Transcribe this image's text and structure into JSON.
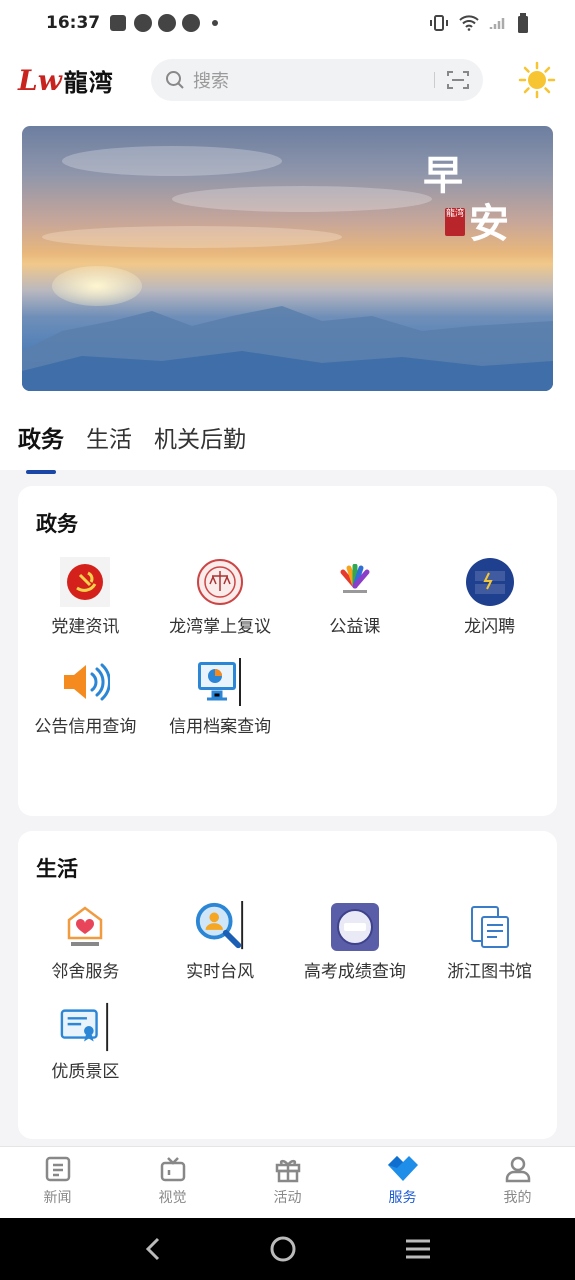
{
  "status_bar": {
    "time": "16:37"
  },
  "header": {
    "logo_mark": "Lw",
    "logo_text": "龍湾",
    "search_placeholder": "搜索"
  },
  "banner": {
    "greeting_line1": "早",
    "greeting_line2": "安",
    "seal_text": "龍湾"
  },
  "tabs": [
    {
      "label": "政务",
      "active": true
    },
    {
      "label": "生活",
      "active": false
    },
    {
      "label": "机关后勤",
      "active": false
    }
  ],
  "sections": [
    {
      "title": "政务",
      "items": [
        {
          "label": "党建资讯",
          "icon": "party-emblem-icon"
        },
        {
          "label": "龙湾掌上复议",
          "icon": "court-seal-icon"
        },
        {
          "label": "公益课",
          "icon": "charity-logo-icon"
        },
        {
          "label": "龙闪聘",
          "icon": "job-recruit-icon"
        },
        {
          "label": "公告信用查询",
          "icon": "speaker-icon"
        },
        {
          "label": "信用档案查询",
          "icon": "monitor-chart-icon"
        }
      ]
    },
    {
      "title": "生活",
      "items": [
        {
          "label": "邻舍服务",
          "icon": "neighbor-heart-icon"
        },
        {
          "label": "实时台风",
          "icon": "search-person-icon"
        },
        {
          "label": "高考成绩查询",
          "icon": "score-query-icon"
        },
        {
          "label": "浙江图书馆",
          "icon": "library-icon"
        },
        {
          "label": "优质景区",
          "icon": "certificate-icon"
        }
      ]
    }
  ],
  "bottom_nav": [
    {
      "label": "新闻",
      "icon": "news-icon",
      "active": false
    },
    {
      "label": "视觉",
      "icon": "tv-icon",
      "active": false
    },
    {
      "label": "活动",
      "icon": "gift-icon",
      "active": false
    },
    {
      "label": "服务",
      "icon": "service-diamond-icon",
      "active": true
    },
    {
      "label": "我的",
      "icon": "user-icon",
      "active": false
    }
  ],
  "colors": {
    "accent": "#1e5bd6",
    "tab_indicator": "#1a46a8",
    "brand_red": "#c8231e"
  }
}
